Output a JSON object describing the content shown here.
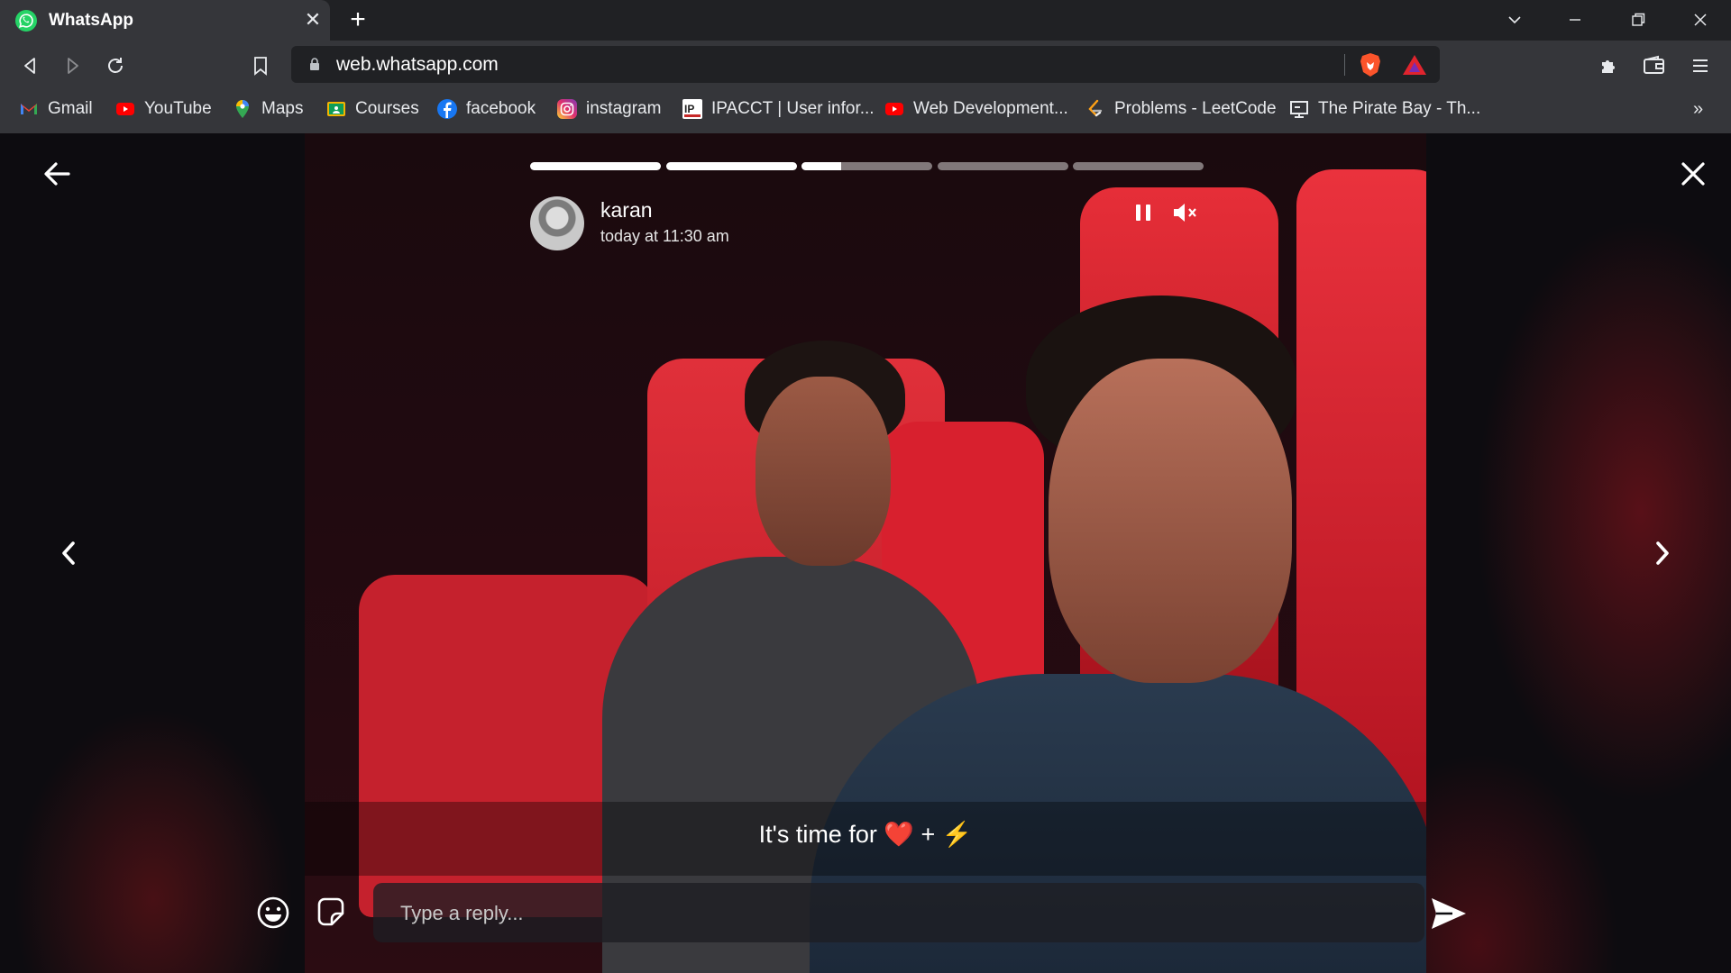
{
  "browser": {
    "tab_title": "WhatsApp",
    "url": "web.whatsapp.com",
    "bookmarks": [
      {
        "label": "Gmail",
        "icon": "gmail-icon",
        "color": "#ea4335"
      },
      {
        "label": "YouTube",
        "icon": "youtube-icon",
        "color": "#ff0000"
      },
      {
        "label": "Maps",
        "icon": "maps-icon",
        "color": "#34a853"
      },
      {
        "label": "Courses",
        "icon": "classroom-icon",
        "color": "#f4b400"
      },
      {
        "label": "facebook",
        "icon": "facebook-icon",
        "color": "#1877f2"
      },
      {
        "label": "instagram",
        "icon": "instagram-icon",
        "color": "#d6249f"
      },
      {
        "label": "IPACCT | User infor...",
        "icon": "ipacct-icon",
        "color": "#ffffff"
      },
      {
        "label": "Web Development...",
        "icon": "youtube-icon",
        "color": "#ff0000"
      },
      {
        "label": "Problems - LeetCode",
        "icon": "leetcode-icon",
        "color": "#ffa116"
      },
      {
        "label": "The Pirate Bay - Th...",
        "icon": "piratebay-icon",
        "color": "#ffffff"
      }
    ]
  },
  "status": {
    "author": "karan",
    "time": "today at 11:30 am",
    "caption": "It's time for ❤️ + ⚡",
    "reply_placeholder": "Type a reply...",
    "progress": [
      1,
      1,
      0.3,
      0,
      0
    ]
  },
  "colors": {
    "chrome_dark": "#202124",
    "chrome_light": "#35363a",
    "whatsapp_green": "#25d366",
    "seat_red": "#d8202e"
  }
}
